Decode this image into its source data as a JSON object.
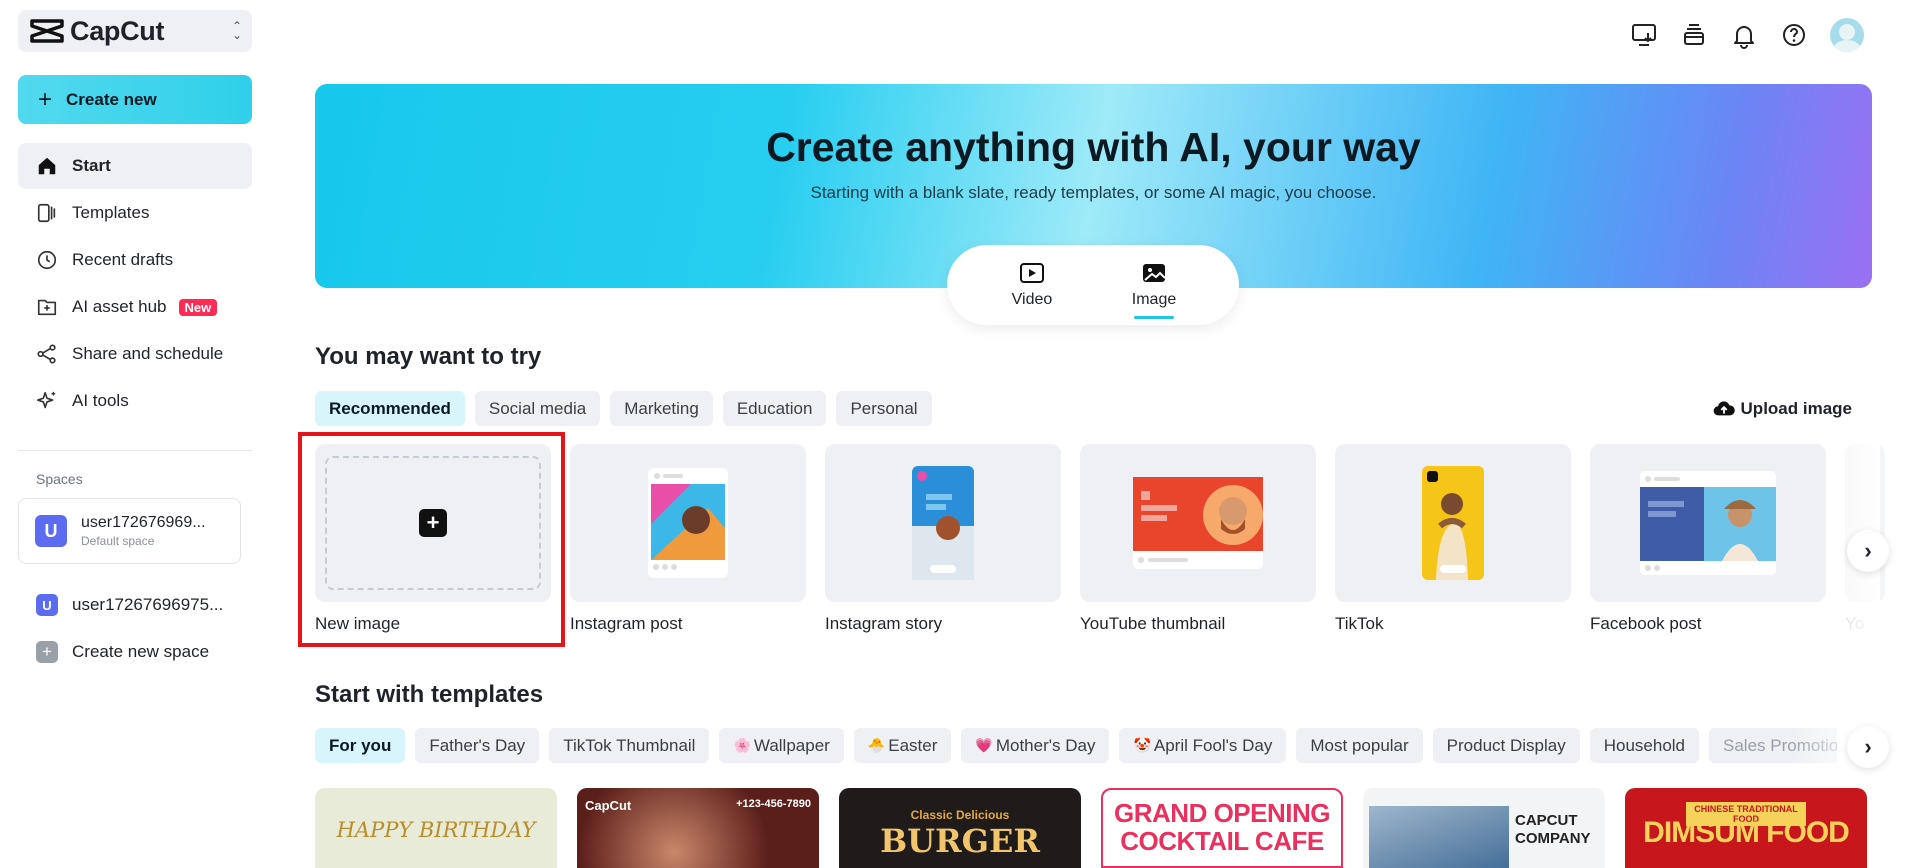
{
  "app": {
    "name": "CapCut"
  },
  "sidebar": {
    "create_label": "Create new",
    "items": [
      {
        "label": "Start",
        "icon": "home-icon"
      },
      {
        "label": "Templates",
        "icon": "templates-icon"
      },
      {
        "label": "Recent drafts",
        "icon": "clock-icon"
      },
      {
        "label": "AI asset hub",
        "icon": "asset-hub-icon",
        "badge": "New"
      },
      {
        "label": "Share and schedule",
        "icon": "share-icon"
      },
      {
        "label": "AI tools",
        "icon": "sparkle-icon"
      }
    ],
    "spaces_label": "Spaces",
    "current_space": {
      "initial": "U",
      "name": "user172676969...",
      "sub": "Default space"
    },
    "space_list": [
      {
        "initial": "U",
        "name": "user17267696975..."
      },
      {
        "initial": "+",
        "name": "Create new space"
      }
    ]
  },
  "hero": {
    "title": "Create anything with AI, your way",
    "subtitle": "Starting with a blank slate, ready templates, or some AI magic, you choose.",
    "modes": [
      {
        "label": "Video",
        "icon": "video-icon"
      },
      {
        "label": "Image",
        "icon": "image-icon",
        "active": true
      }
    ]
  },
  "try_section": {
    "title": "You may want to try",
    "tabs": [
      "Recommended",
      "Social media",
      "Marketing",
      "Education",
      "Personal"
    ],
    "upload_label": "Upload image",
    "cards": [
      "New image",
      "Instagram post",
      "Instagram story",
      "YouTube thumbnail",
      "TikTok",
      "Facebook post",
      "Yo"
    ]
  },
  "templates_section": {
    "title": "Start with templates",
    "tabs": [
      {
        "label": "For you"
      },
      {
        "label": "Father's Day"
      },
      {
        "label": "TikTok Thumbnail"
      },
      {
        "label": "Wallpaper",
        "emoji": "🌸"
      },
      {
        "label": "Easter",
        "emoji": "🐣"
      },
      {
        "label": "Mother's Day",
        "emoji": "💗"
      },
      {
        "label": "April Fool's Day",
        "emoji": "🤡"
      },
      {
        "label": "Most popular"
      },
      {
        "label": "Product Display"
      },
      {
        "label": "Household"
      },
      {
        "label": "Sales Promotion"
      }
    ],
    "thumbs": [
      {
        "text": "HAPPY BIRTHDAY"
      },
      {
        "text": "CapCut",
        "extra": "+123-456-7890"
      },
      {
        "text": "BURGER",
        "small": "Classic Delicious"
      },
      {
        "text": "GRAND OPENING",
        "text2": "COCKTAIL CAFE"
      },
      {
        "text": "CAPCUT",
        "text2": "COMPANY"
      },
      {
        "text": "DIMSUM FOOD",
        "small": "CHINESE TRADITIONAL FOOD"
      }
    ]
  },
  "colors": {
    "accent": "#2fd0ea",
    "highlight": "#e3151a",
    "badge": "#fe2c55"
  }
}
